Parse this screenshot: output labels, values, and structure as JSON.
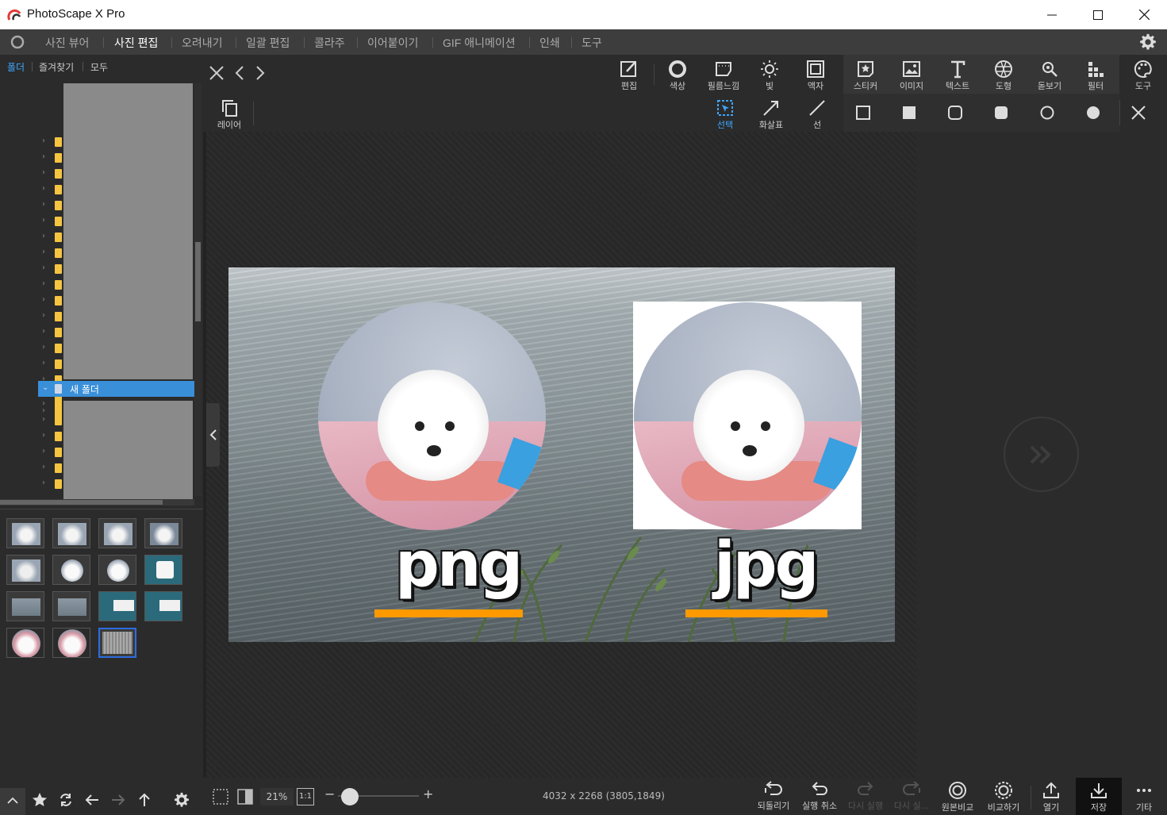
{
  "app": {
    "title": "PhotoScape X Pro"
  },
  "menu": {
    "items": [
      "사진 뷰어",
      "사진 편집",
      "오려내기",
      "일괄 편집",
      "콜라주",
      "이어붙이기",
      "GIF 애니메이션",
      "인쇄",
      "도구"
    ],
    "active_index": 1
  },
  "left_panel": {
    "tabs": [
      "폴더",
      "즐겨찾기",
      "모두"
    ],
    "selected_folder": "새 폴더"
  },
  "toolbar": {
    "tools": [
      "편집",
      "색상",
      "필름느낌",
      "빛",
      "액자",
      "스티커",
      "이미지",
      "텍스트",
      "도형",
      "돋보기",
      "필터",
      "도구"
    ],
    "layer_label": "레이어",
    "draw_tools": [
      "선택",
      "화살표",
      "선"
    ],
    "selected_draw_tool": "선택"
  },
  "canvas": {
    "image_texts": [
      "png",
      "jpg"
    ],
    "accent_color": "#ff9900"
  },
  "status": {
    "zoom": "21%",
    "actual_size": "1:1",
    "image_info": "4032 x 2268 (3805,1849)",
    "buttons": [
      "되돌리기",
      "실행 취소",
      "다시 실행",
      "다시 실...",
      "원본비교",
      "비교하기",
      "열기",
      "저장",
      "기타"
    ],
    "disabled": [
      "다시 실행",
      "다시 실..."
    ]
  },
  "colors": {
    "selection": "#3a8fd9",
    "selected_text": "#3ea6ff",
    "folder": "#f5c542"
  }
}
